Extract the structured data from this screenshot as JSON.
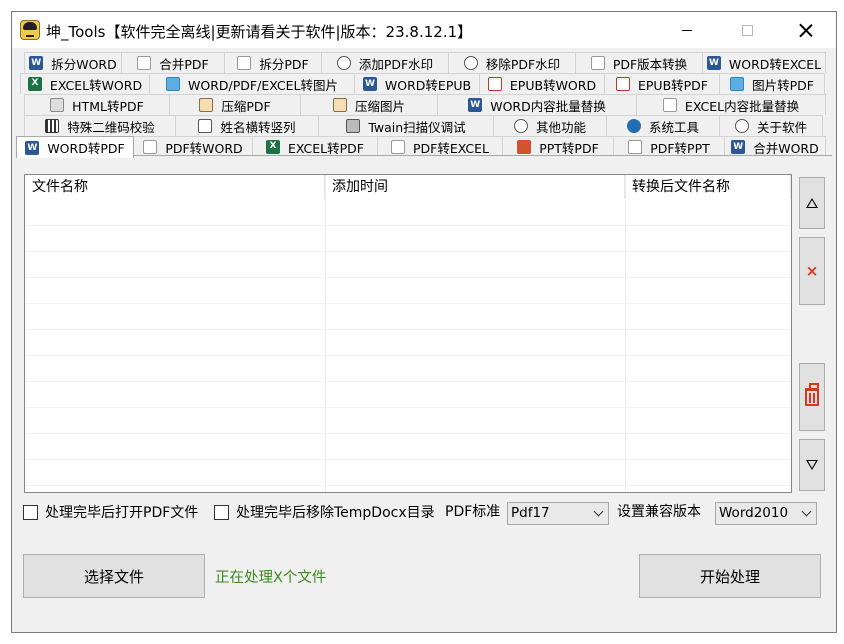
{
  "window": {
    "title": "坤_Tools【软件完全离线|更新请看关于软件|版本：23.8.12.1】"
  },
  "tabs": {
    "row1": [
      {
        "label": "拆分WORD",
        "icon": "word-icon"
      },
      {
        "label": "合并PDF",
        "icon": "pdf-icon"
      },
      {
        "label": "拆分PDF",
        "icon": "pdf-icon"
      },
      {
        "label": "添加PDF水印",
        "icon": "watermark-icon"
      },
      {
        "label": "移除PDF水印",
        "icon": "watermark-icon"
      },
      {
        "label": "PDF版本转换",
        "icon": "pdf-icon"
      },
      {
        "label": "WORD转EXCEL",
        "icon": "word-icon"
      }
    ],
    "row2": [
      {
        "label": "EXCEL转WORD",
        "icon": "excel-icon"
      },
      {
        "label": "WORD/PDF/EXCEL转图片",
        "icon": "image-icon"
      },
      {
        "label": "WORD转EPUB",
        "icon": "word-icon"
      },
      {
        "label": "EPUB转WORD",
        "icon": "epub-icon"
      },
      {
        "label": "EPUB转PDF",
        "icon": "epub-icon"
      },
      {
        "label": "图片转PDF",
        "icon": "image-icon"
      }
    ],
    "row3": [
      {
        "label": "HTML转PDF",
        "icon": "html-icon"
      },
      {
        "label": "压缩PDF",
        "icon": "compress-icon"
      },
      {
        "label": "压缩图片",
        "icon": "compress-icon"
      },
      {
        "label": "WORD内容批量替换",
        "icon": "word-icon"
      },
      {
        "label": "EXCEL内容批量替换",
        "icon": "excel-icon"
      }
    ],
    "row4": [
      {
        "label": "特殊二维码校验",
        "icon": "qrcode-icon"
      },
      {
        "label": "姓名横转竖列",
        "icon": "rotate-icon"
      },
      {
        "label": "Twain扫描仪调试",
        "icon": "scanner-icon"
      },
      {
        "label": "其他功能",
        "icon": "more-icon"
      },
      {
        "label": "系统工具",
        "icon": "gear-icon"
      },
      {
        "label": "关于软件",
        "icon": "info-icon"
      }
    ],
    "row5": [
      {
        "label": "WORD转PDF",
        "icon": "word-icon",
        "active": true
      },
      {
        "label": "PDF转WORD",
        "icon": "pdf-icon"
      },
      {
        "label": "EXCEL转PDF",
        "icon": "excel-icon"
      },
      {
        "label": "PDF转EXCEL",
        "icon": "pdf-icon"
      },
      {
        "label": "PPT转PDF",
        "icon": "ppt-icon"
      },
      {
        "label": "PDF转PPT",
        "icon": "pdf-icon"
      },
      {
        "label": "合并WORD",
        "icon": "word-icon"
      }
    ]
  },
  "file_table": {
    "columns": [
      "文件名称",
      "添加时间",
      "转换后文件名称"
    ],
    "rows": []
  },
  "options": {
    "open_pdf_after": "处理完毕后打开PDF文件",
    "remove_temp_docx": "处理完毕后移除TempDocx目录",
    "pdf_standard_label": "PDF标准",
    "pdf_standard_value": "Pdf17",
    "compat_label": "设置兼容版本",
    "compat_value": "Word2010"
  },
  "actions": {
    "select_files": "选择文件",
    "status": "正在处理X个文件",
    "start": "开始处理"
  },
  "colors": {
    "status_text": "#3b8a1e",
    "danger": "#d9361e"
  }
}
